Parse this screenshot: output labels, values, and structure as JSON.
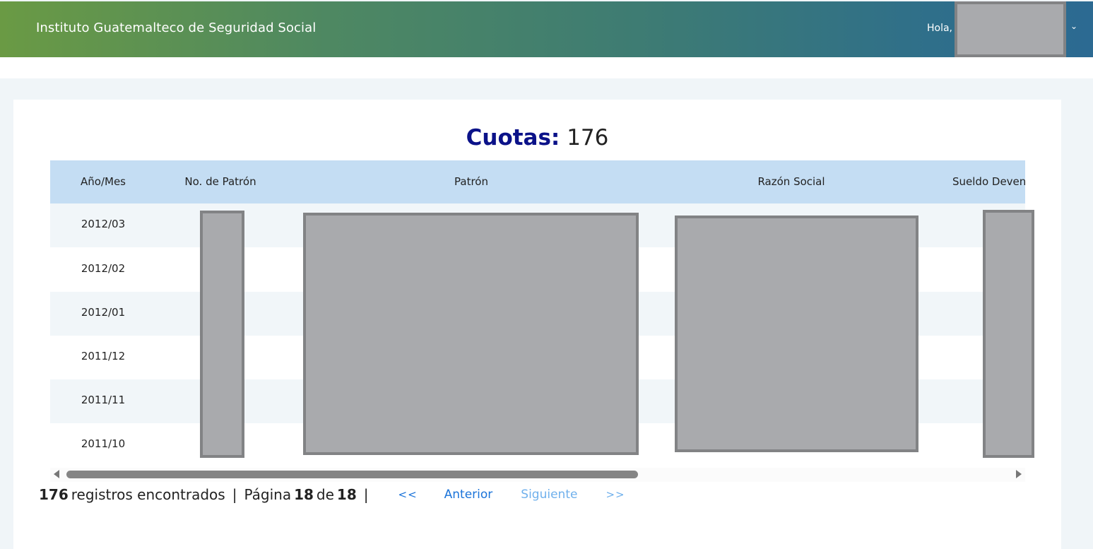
{
  "header": {
    "title": "Instituto Guatemalteco de Seguridad Social",
    "greeting": "Hola,",
    "user_menu_icon": "chevron-down-icon",
    "gradient_start": "#6a9a44",
    "gradient_end": "#2c6a92"
  },
  "main": {
    "heading_label": "Cuotas:",
    "heading_value": "176",
    "heading_color": "#0b1289"
  },
  "table": {
    "columns": [
      "Año/Mes",
      "No. de Patrón",
      "Patrón",
      "Razón Social",
      "Sueldo Deven"
    ],
    "rows": [
      {
        "periodo": "2012/03"
      },
      {
        "periodo": "2012/02"
      },
      {
        "periodo": "2012/01"
      },
      {
        "periodo": "2011/12"
      },
      {
        "periodo": "2011/11"
      },
      {
        "periodo": "2011/10"
      }
    ],
    "header_bg": "#c4ddf3"
  },
  "pagination": {
    "total": "176",
    "records_text": "registros encontrados",
    "page_label": "Página",
    "current_page": "18",
    "of_label": "de",
    "total_pages": "18",
    "separator": "|",
    "first": "<<",
    "prev": "Anterior",
    "next": "Siguiente",
    "last": ">>"
  }
}
